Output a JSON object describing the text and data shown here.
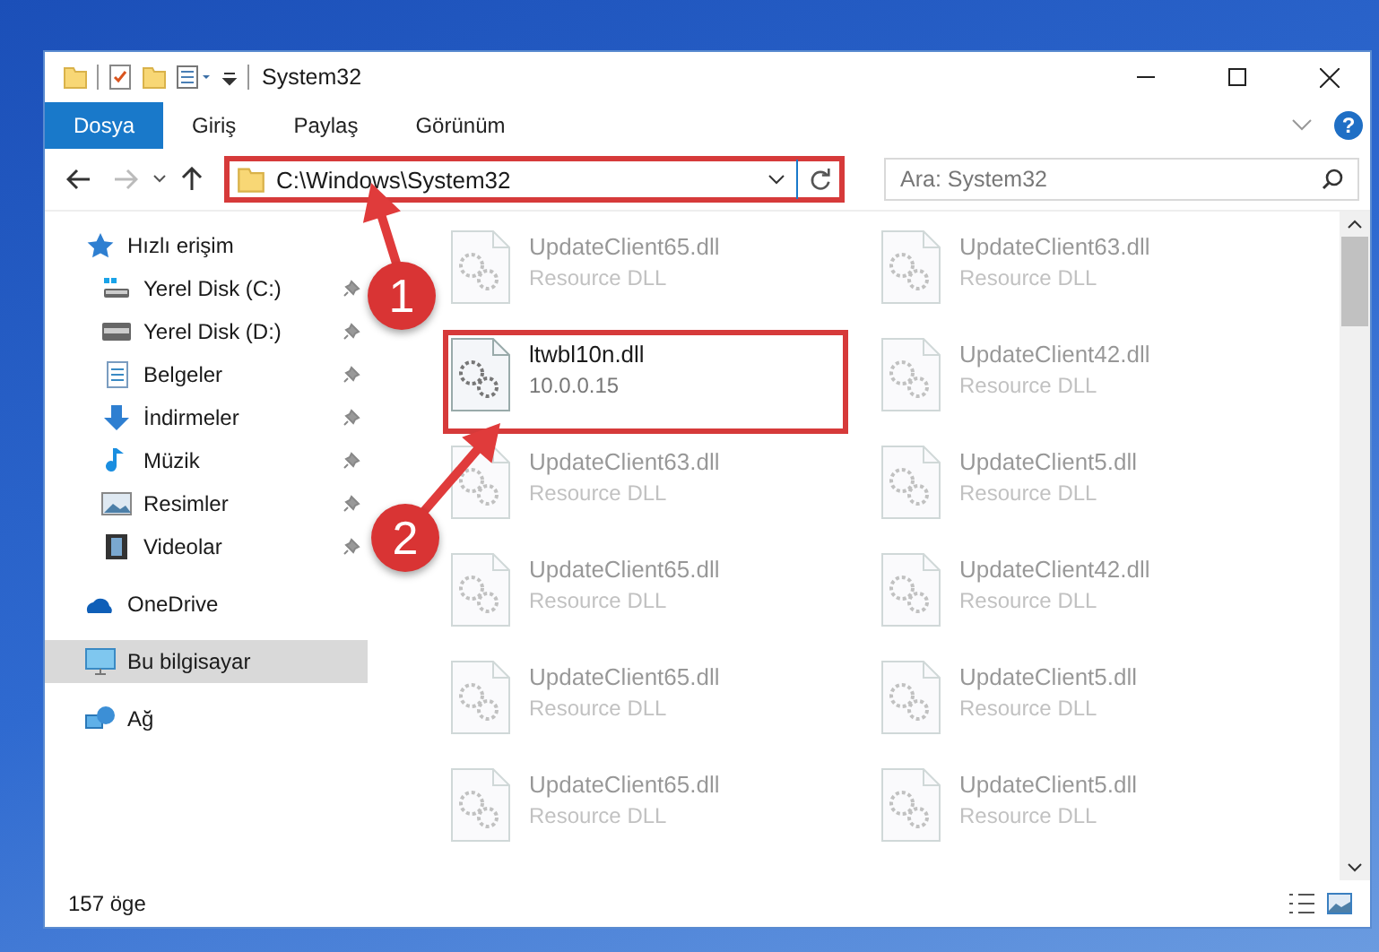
{
  "window": {
    "title": "System32"
  },
  "ribbon_tabs": [
    {
      "label": "Dosya",
      "selected": true
    },
    {
      "label": "Giriş",
      "selected": false
    },
    {
      "label": "Paylaş",
      "selected": false
    },
    {
      "label": "Görünüm",
      "selected": false
    }
  ],
  "help_symbol": "?",
  "address": {
    "path": "C:\\Windows\\System32",
    "highlighted": true
  },
  "search": {
    "placeholder": "Ara: System32"
  },
  "nav": [
    {
      "label": "Hızlı erişim",
      "kind": "star",
      "selected": false,
      "children": [
        {
          "label": "Yerel Disk (C:)",
          "kind": "drive-win",
          "pinned": true,
          "selected": false
        },
        {
          "label": "Yerel Disk (D:)",
          "kind": "drive",
          "pinned": true,
          "selected": false
        },
        {
          "label": "Belgeler",
          "kind": "document",
          "pinned": true,
          "selected": false
        },
        {
          "label": "İndirmeler",
          "kind": "download",
          "pinned": true,
          "selected": false
        },
        {
          "label": "Müzik",
          "kind": "music",
          "pinned": true,
          "selected": false
        },
        {
          "label": "Resimler",
          "kind": "pictures",
          "pinned": true,
          "selected": false
        },
        {
          "label": "Videolar",
          "kind": "videos",
          "pinned": true,
          "selected": false
        }
      ]
    },
    {
      "label": "OneDrive",
      "kind": "cloud",
      "selected": false
    },
    {
      "label": "Bu bilgisayar",
      "kind": "computer",
      "selected": true
    },
    {
      "label": "Ağ",
      "kind": "network",
      "selected": false
    }
  ],
  "files": [
    {
      "name": "UpdateClient65.dll",
      "detail": "Resource DLL",
      "faded": true,
      "highlighted": false
    },
    {
      "name": "UpdateClient63.dll",
      "detail": "Resource DLL",
      "faded": true,
      "highlighted": false
    },
    {
      "name": "ltwbl10n.dll",
      "detail": "10.0.0.15",
      "faded": false,
      "highlighted": true
    },
    {
      "name": "UpdateClient42.dll",
      "detail": "Resource DLL",
      "faded": true,
      "highlighted": false
    },
    {
      "name": "UpdateClient63.dll",
      "detail": "Resource DLL",
      "faded": true,
      "highlighted": false
    },
    {
      "name": "UpdateClient5.dll",
      "detail": "Resource DLL",
      "faded": true,
      "highlighted": false
    },
    {
      "name": "UpdateClient65.dll",
      "detail": "Resource DLL",
      "faded": true,
      "highlighted": false
    },
    {
      "name": "UpdateClient42.dll",
      "detail": "Resource DLL",
      "faded": true,
      "highlighted": false
    },
    {
      "name": "UpdateClient65.dll",
      "detail": "Resource DLL",
      "faded": true,
      "highlighted": false
    },
    {
      "name": "UpdateClient5.dll",
      "detail": "Resource DLL",
      "faded": true,
      "highlighted": false
    },
    {
      "name": "UpdateClient65.dll",
      "detail": "Resource DLL",
      "faded": true,
      "highlighted": false
    },
    {
      "name": "UpdateClient5.dll",
      "detail": "Resource DLL",
      "faded": true,
      "highlighted": false
    }
  ],
  "status_bar": {
    "item_count": "157 öge"
  },
  "annotations": [
    {
      "number": "1"
    },
    {
      "number": "2"
    }
  ]
}
